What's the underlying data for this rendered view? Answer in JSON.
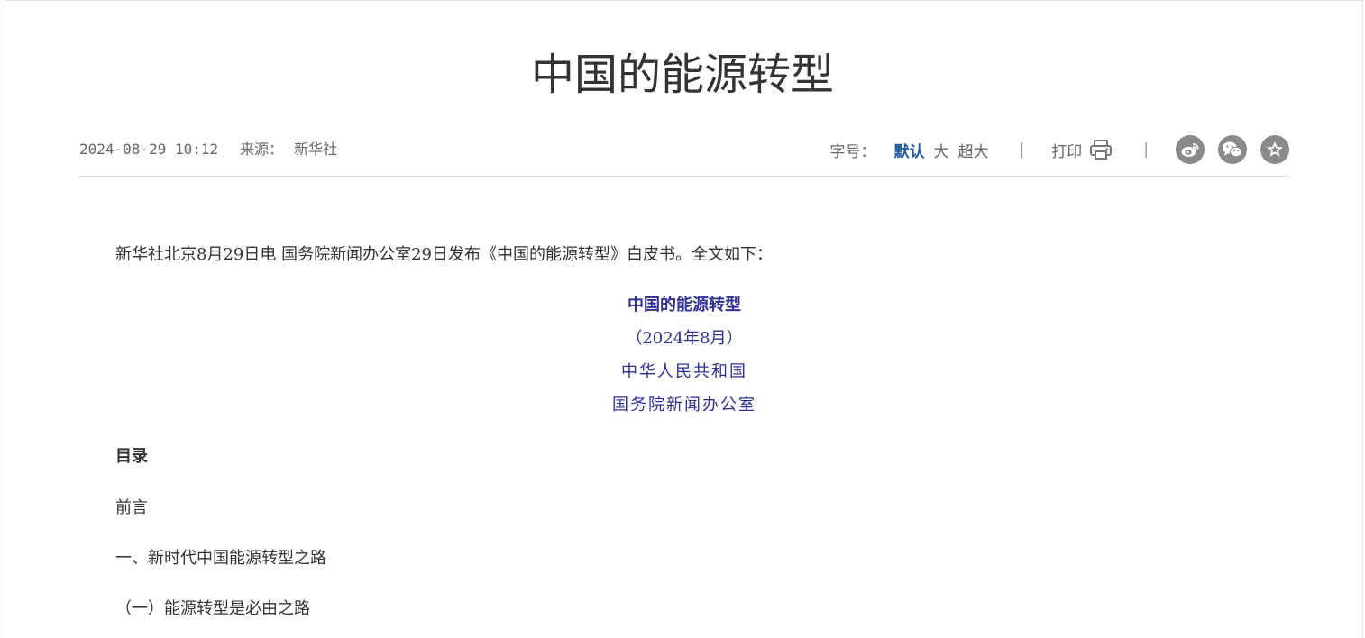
{
  "article": {
    "title": "中国的能源转型",
    "date": "2024-08-29 10:12",
    "source_label": "来源：",
    "source_name": "新华社"
  },
  "toolbar": {
    "font_size_label": "字号：",
    "font_options": [
      "默认",
      "大",
      "超大"
    ],
    "active_font_option": "默认",
    "separator": "|",
    "print_label": "打印",
    "share_icons": [
      "weibo-icon",
      "wechat-icon",
      "favorite-star-icon"
    ],
    "accent_color": "#1f5a9b"
  },
  "body": {
    "intro": "新华社北京8月29日电 国务院新闻办公室29日发布《中国的能源转型》白皮书。全文如下：",
    "doc_title": "中国的能源转型",
    "doc_date": "（2024年8月）",
    "doc_country": "中华人民共和国",
    "doc_office": "国务院新闻办公室",
    "toc_heading": "目录",
    "toc_items": [
      "前言",
      "一、新时代中国能源转型之路",
      "（一）能源转型是必由之路"
    ],
    "center_text_color": "#2e3192"
  }
}
